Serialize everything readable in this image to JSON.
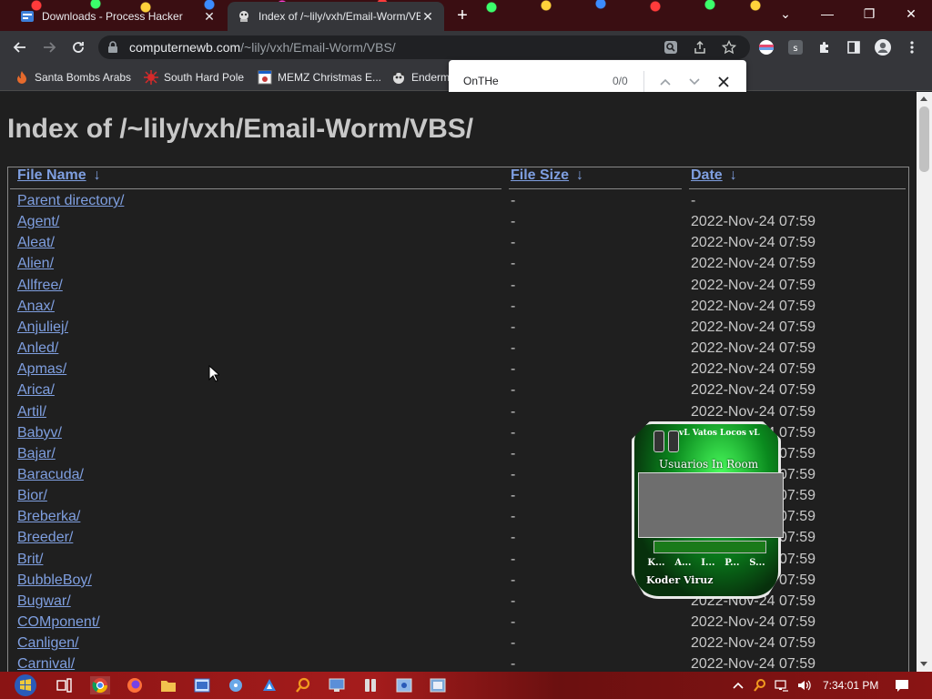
{
  "browser": {
    "tabs": [
      {
        "title": "Downloads - Process Hacker"
      },
      {
        "title": "Index of /~lily/vxh/Email-Worm/VBS/"
      }
    ],
    "close_glyph": "✕",
    "new_tab_glyph": "+",
    "url_host": "computernewb.com",
    "url_path": "/~lily/vxh/Email-Worm/VBS/",
    "window_controls": {
      "dropdown": "⌄",
      "minimize": "—",
      "restore": "❐",
      "close": "✕"
    }
  },
  "bookmarks": [
    {
      "label": "Santa Bombs Arabs"
    },
    {
      "label": "South Hard Pole"
    },
    {
      "label": "MEMZ Christmas E..."
    },
    {
      "label": "Enderm"
    }
  ],
  "findbar": {
    "query": "OnTHe",
    "count": "0/0"
  },
  "page": {
    "title": "Index of /~lily/vxh/Email-Worm/VBS/",
    "headers": {
      "name": "File Name",
      "size": "File Size",
      "date": "Date",
      "sort_arrow": "↓"
    },
    "rows": [
      {
        "name": "Parent directory/",
        "size": "-",
        "date": "-"
      },
      {
        "name": "Agent/",
        "size": "-",
        "date": "2022-Nov-24 07:59"
      },
      {
        "name": "Aleat/",
        "size": "-",
        "date": "2022-Nov-24 07:59"
      },
      {
        "name": "Alien/",
        "size": "-",
        "date": "2022-Nov-24 07:59"
      },
      {
        "name": "Allfree/",
        "size": "-",
        "date": "2022-Nov-24 07:59"
      },
      {
        "name": "Anax/",
        "size": "-",
        "date": "2022-Nov-24 07:59"
      },
      {
        "name": "Anjuliej/",
        "size": "-",
        "date": "2022-Nov-24 07:59"
      },
      {
        "name": "Anled/",
        "size": "-",
        "date": "2022-Nov-24 07:59"
      },
      {
        "name": "Apmas/",
        "size": "-",
        "date": "2022-Nov-24 07:59"
      },
      {
        "name": "Arica/",
        "size": "-",
        "date": "2022-Nov-24 07:59"
      },
      {
        "name": "Artil/",
        "size": "-",
        "date": "2022-Nov-24 07:59"
      },
      {
        "name": "Babyv/",
        "size": "-",
        "date": "2022-Nov-24 07:59"
      },
      {
        "name": "Bajar/",
        "size": "-",
        "date": "2022-Nov-24 07:59"
      },
      {
        "name": "Baracuda/",
        "size": "-",
        "date": "2022-Nov-24 07:59"
      },
      {
        "name": "Bior/",
        "size": "-",
        "date": "2022-Nov-24 07:59"
      },
      {
        "name": "Breberka/",
        "size": "-",
        "date": "2022-Nov-24 07:59"
      },
      {
        "name": "Breeder/",
        "size": "-",
        "date": "2022-Nov-24 07:59"
      },
      {
        "name": "Brit/",
        "size": "-",
        "date": "2022-Nov-24 07:59"
      },
      {
        "name": "BubbleBoy/",
        "size": "-",
        "date": "2022-Nov-24 07:59"
      },
      {
        "name": "Bugwar/",
        "size": "-",
        "date": "2022-Nov-24 07:59"
      },
      {
        "name": "COMponent/",
        "size": "-",
        "date": "2022-Nov-24 07:59"
      },
      {
        "name": "Canligen/",
        "size": "-",
        "date": "2022-Nov-24 07:59"
      },
      {
        "name": "Carnival/",
        "size": "-",
        "date": "2022-Nov-24 07:59"
      }
    ]
  },
  "widget": {
    "title": "vL Vatos Locos vL",
    "subtitle": "Usuarios In Room",
    "buttons": [
      "K...",
      "A...",
      "I...",
      "P...",
      "S..."
    ],
    "footer": "Koder Viruz"
  },
  "taskbar": {
    "clock": "7:34:01 PM"
  },
  "colors": {
    "link": "#7f9fe0",
    "page_bg": "#1f1f1f",
    "text": "#c8c8c8",
    "taskbar": "#8a1414"
  }
}
